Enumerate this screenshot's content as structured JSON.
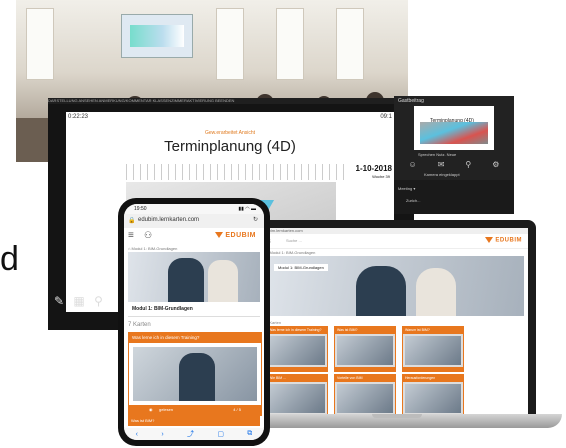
{
  "photo": {
    "screen_caption": ""
  },
  "presentation": {
    "top_bar": "DARSTELLUNG ANSEHEN   ANMERKUNG/KOMMENTAR   KLASSENZIMMERAKTIVIERUNG BEENDEN",
    "time": "0:22:23",
    "page_indicator": "09:1",
    "slide_subtitle": "Gew.erarbeitet Ansicht",
    "slide_title": "Terminplanung (4D)",
    "slide_date": "1-10-2018",
    "slide_date_sub": "Woche 39",
    "tools": [
      "✎",
      "▦",
      "⚲"
    ]
  },
  "meeting": {
    "title": "Gastbeitrag",
    "thumb_title": "Terminplanung (4D)",
    "participants_label": "Sprechen    Nutz. Neue",
    "status": "Kamera eingeklappt",
    "meeting_label": "Meeting ▾",
    "names": [
      "Zurich..."
    ]
  },
  "laptop": {
    "top_url": "edubim.lernkarten.com",
    "search_placeholder": "Suche ...",
    "logo": "EDUBIM",
    "breadcrumb": "⌂  Modul 1: BIM-Grundlagen",
    "hero_pill": "Modul 1: BIM-Grundlagen",
    "section": "7 Karten",
    "cards": [
      {
        "label": "Was lerne ich in diesem Training?"
      },
      {
        "label": "Was ist BIM?"
      },
      {
        "label": "Warum ist BIM?"
      },
      {
        "label": "Wie BIM ..."
      },
      {
        "label": "Vorteile von BIM"
      },
      {
        "label": "Herausforderungen"
      }
    ]
  },
  "phone": {
    "status_time": "19:50",
    "status_icons": "▮▮ ◠ ▬",
    "url": "edubim.lernkarten.com",
    "logo": "EDUBIM",
    "breadcrumb": "⌂  Modul 1: BIM-Grundlagen",
    "module_title": "Modul 1: BIM-Grundlagen",
    "cards_count": "7 Karten",
    "card_header": "Was lerne ich in diesem Training?",
    "card_footer_left": "gelesen",
    "card_footer_right": "4 / 5",
    "card2_header": "Was ist BIM?",
    "home_icons": [
      "‹",
      "›",
      "⤴",
      "▢",
      "⧉"
    ]
  },
  "left_letter": "d"
}
